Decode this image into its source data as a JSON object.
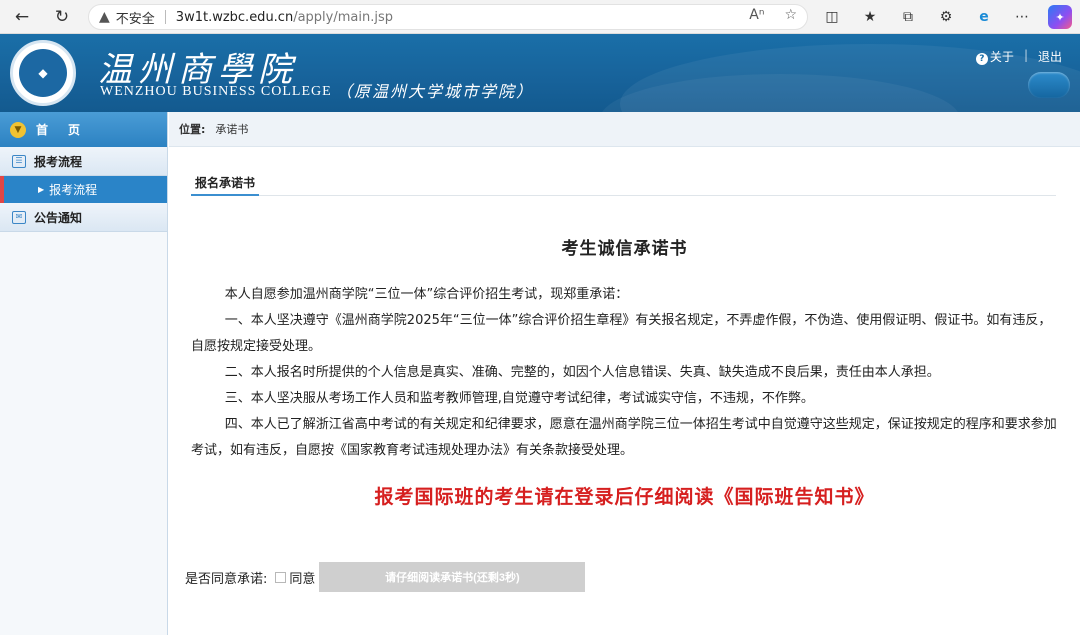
{
  "browser": {
    "security_label": "不安全",
    "url_host": "3w1t.wzbc.edu.cn",
    "url_path": "/apply/main.jsp"
  },
  "header": {
    "logo_text": "温州商学院",
    "brand_cn": "温州商學院",
    "brand_en": "WENZHOU BUSINESS COLLEGE",
    "brand_sub": "（原温州大学城市学院）",
    "about_label": "关于",
    "logout_label": "退出"
  },
  "sidebar": {
    "home_label": "首页",
    "sections": [
      {
        "label": "报考流程",
        "items": [
          {
            "label": "报考流程",
            "active": true
          }
        ]
      },
      {
        "label": "公告通知",
        "items": []
      }
    ]
  },
  "main": {
    "location_label": "位置:",
    "location_value": "承诺书",
    "tab_label": "报名承诺书",
    "doc_title": "考生诚信承诺书",
    "paragraphs": [
      "本人自愿参加温州商学院“三位一体”综合评价招生考试，现郑重承诺：",
      "一、本人坚决遵守《温州商学院2025年“三位一体”综合评价招生章程》有关报名规定，不弄虚作假，不伪造、使用假证明、假证书。如有违反，自愿按规定接受处理。",
      "二、本人报名时所提供的个人信息是真实、准确、完整的，如因个人信息错误、失真、缺失造成不良后果，责任由本人承担。",
      "三、本人坚决服从考场工作人员和监考教师管理,自觉遵守考试纪律，考试诚实守信，不违规，不作弊。",
      "四、本人已了解浙江省高中考试的有关规定和纪律要求，愿意在温州商学院三位一体招生考试中自觉遵守这些规定，保证按规定的程序和要求参加考试，如有违反，自愿按《国家教育考试违规处理办法》有关条款接受处理。"
    ],
    "notice": "报考国际班的考生请在登录后仔细阅读《国际班告知书》",
    "agree_question": "是否同意承诺:",
    "agree_label": "同意",
    "read_button": "请仔细阅读承诺书(还剩3秒)"
  },
  "colors": {
    "header_blue": "#1a6fa8",
    "active_blue": "#2a84c8",
    "notice_red": "#d61f1f",
    "disabled_gray": "#cfcfcf"
  }
}
